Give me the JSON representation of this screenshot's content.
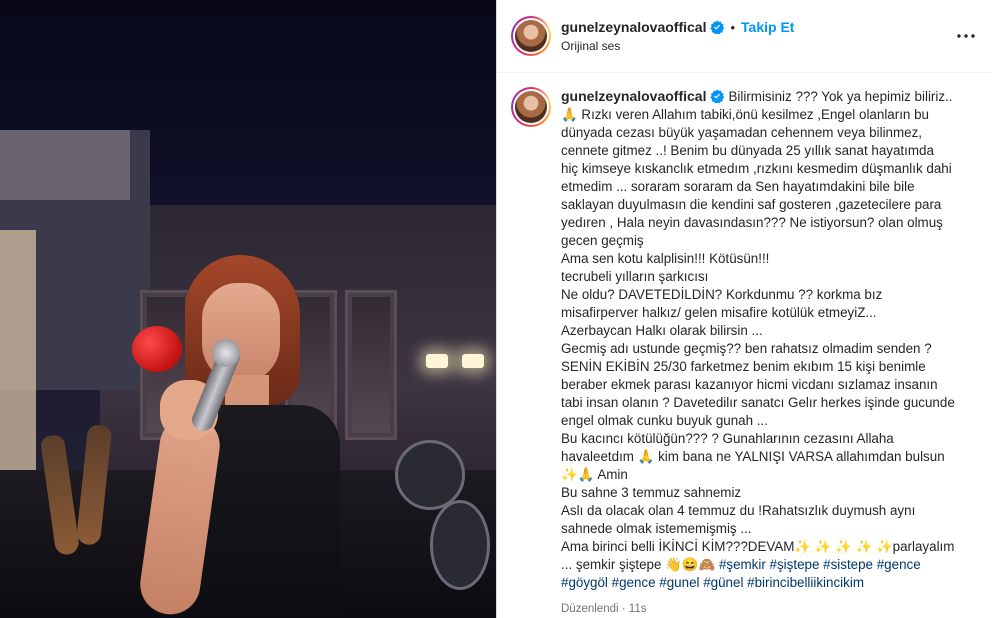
{
  "header": {
    "username": "gunelzeynalovaoffical",
    "separator": "•",
    "follow_label": "Takip Et",
    "audio_label": "Orijinal ses"
  },
  "caption": {
    "username": "gunelzeynalovaoffical",
    "first_line": "Bilirmisiniz ??? Yok ya hepimiz biliriz..",
    "lines": [
      "🙏 Rızkı veren Allahım tabiki,önü kesilmez ,Engel olanların bu",
      "dünyada cezası büyük yaşamadan cehennem veya bilinmez,",
      "cennete gitmez ..! Benim bu dünyada 25 yıllık sanat hayatımda",
      "hiç kimseye kıskanclık etmedım ,rızkını kesmedim düşmanlık dahi",
      "etmedim ... soraram soraram da Sen hayatımdakini bile bile",
      "saklayan duyulmasın die kendini saf gosteren ,gazetecilere para",
      "yedıren , Hala neyin davasındasın??? Ne istiyorsun? olan olmuş",
      "gecen geçmiş",
      "Ama sen kotu kalplisin!!! Kötüsün!!!",
      "tecrubeli yılların şarkıcısı",
      "Ne oldu? DAVETEDİLDİN? Korkdunmu ?? korkma bız",
      "misafirperver halkız/ gelen misafire kotülük etmeyiZ...",
      "Azerbaycan Halkı olarak bilirsin ...",
      "Gecmiş adı ustunde geçmiş?? ben rahatsız olmadim senden ?",
      "SENİN EKİBİN 25/30 farketmez benim ekıbım 15 kişi benimle",
      "beraber ekmek parası kazanıyor hicmi vicdanı sızlamaz insanın",
      "tabi insan olanın ? Davetedilır sanatcı Gelır herkes işinde gucunde",
      "engel olmak cunku buyuk gunah ...",
      "Bu kacıncı kötülüğün??? ? Gunahlarının cezasını Allaha",
      "havaleetdım 🙏 kim bana ne YALNIŞI VARSA allahımdan bulsun",
      "✨🙏 Amin",
      "Bu sahne 3 temmuz sahnemiz",
      "Aslı da olacak olan 4 temmuz du !Rahatsızlık duymush aynı",
      "sahnede olmak istememişmiş ...",
      "Ama birinci belli İKİNCİ KİM???DEVAM✨ ✨ ✨ ✨ ✨parlayalım"
    ],
    "tag_line_1_prefix": "... şemkir şiştepe 👋😄🙈",
    "tag_line_1_tags": "#şemkir #şiştepe #sistepe #gence",
    "tag_line_2": "#göygöl #gence #gunel #günel #birincibelliikincikim",
    "edited_label": "Düzenlendi",
    "time_label": "11s"
  },
  "icons": {
    "verified": "verified-badge-icon",
    "more": "more-options-icon"
  },
  "colors": {
    "accent": "#0095f6",
    "hashtag": "#00376b",
    "muted": "#737373"
  }
}
